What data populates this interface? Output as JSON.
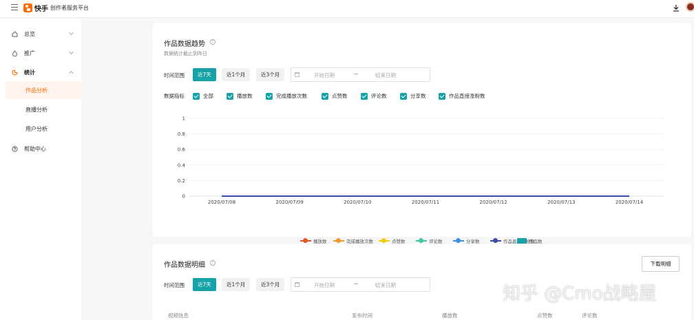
{
  "header": {
    "brand_name": "快手",
    "brand_sub": "创作者服务平台"
  },
  "sidebar": {
    "items": [
      {
        "label": "总览"
      },
      {
        "label": "推广"
      },
      {
        "label": "统计"
      },
      {
        "label": "帮助中心"
      }
    ],
    "sub_items": [
      {
        "label": "作品分析",
        "selected": true
      },
      {
        "label": "直播分析"
      },
      {
        "label": "用户分析"
      }
    ]
  },
  "trend": {
    "title": "作品数据趋势",
    "subtitle": "数据统计截止到昨日",
    "range_label": "时间范围",
    "ranges": [
      "近7天",
      "近1个月",
      "近3个月"
    ],
    "date_start_placeholder": "开始日期",
    "date_sep": "~",
    "date_end_placeholder": "结束日期",
    "metrics_label": "数据指标",
    "metrics": [
      "全部",
      "播放数",
      "完成播放次数",
      "点赞数",
      "评论数",
      "分享数",
      "作品直接涨粉数"
    ]
  },
  "chart_data": {
    "type": "line",
    "x": [
      "2020/07/08",
      "2020/07/09",
      "2020/07/10",
      "2020/07/11",
      "2020/07/12",
      "2020/07/13",
      "2020/07/14"
    ],
    "ylim": [
      0,
      1
    ],
    "yticks": [
      "1",
      "0.8",
      "0.6",
      "0.4",
      "0.2",
      "0"
    ],
    "grid": true,
    "legend_position": "bottom",
    "series": [
      {
        "name": "播放数",
        "color": "#e8541e",
        "values": [
          0,
          0,
          0,
          0,
          0,
          0,
          0
        ]
      },
      {
        "name": "完成播放次数",
        "color": "#f39a2b",
        "values": [
          0,
          0,
          0,
          0,
          0,
          0,
          0
        ]
      },
      {
        "name": "点赞数",
        "color": "#f5cc00",
        "values": [
          0,
          0,
          0,
          0,
          0,
          0,
          0
        ]
      },
      {
        "name": "评论数",
        "color": "#3cc9a0",
        "values": [
          0,
          0,
          0,
          0,
          0,
          0,
          0
        ]
      },
      {
        "name": "分享数",
        "color": "#3a8ee6",
        "values": [
          0,
          0,
          0,
          0,
          0,
          0,
          0
        ]
      },
      {
        "name": "作品直接涨粉数",
        "color": "#3d4aa8",
        "values": [
          0,
          0,
          0,
          0,
          0,
          0,
          0
        ]
      },
      {
        "name": "作品数",
        "color": "#17a2a8",
        "type": "bar",
        "values": [
          0,
          0,
          0,
          0,
          0,
          0,
          0
        ]
      }
    ]
  },
  "detail": {
    "title": "作品数据明细",
    "download_label": "下载明细",
    "range_label": "时间范围",
    "ranges": [
      "近7天",
      "近1个月",
      "近3个月"
    ],
    "date_start_placeholder": "开始日期",
    "date_sep": "~",
    "date_end_placeholder": "结束日期",
    "columns": [
      "视频信息",
      "发布时间",
      "播放数",
      "点赞数",
      "评论数"
    ]
  },
  "watermark": "知乎 @Cmo战略屋"
}
